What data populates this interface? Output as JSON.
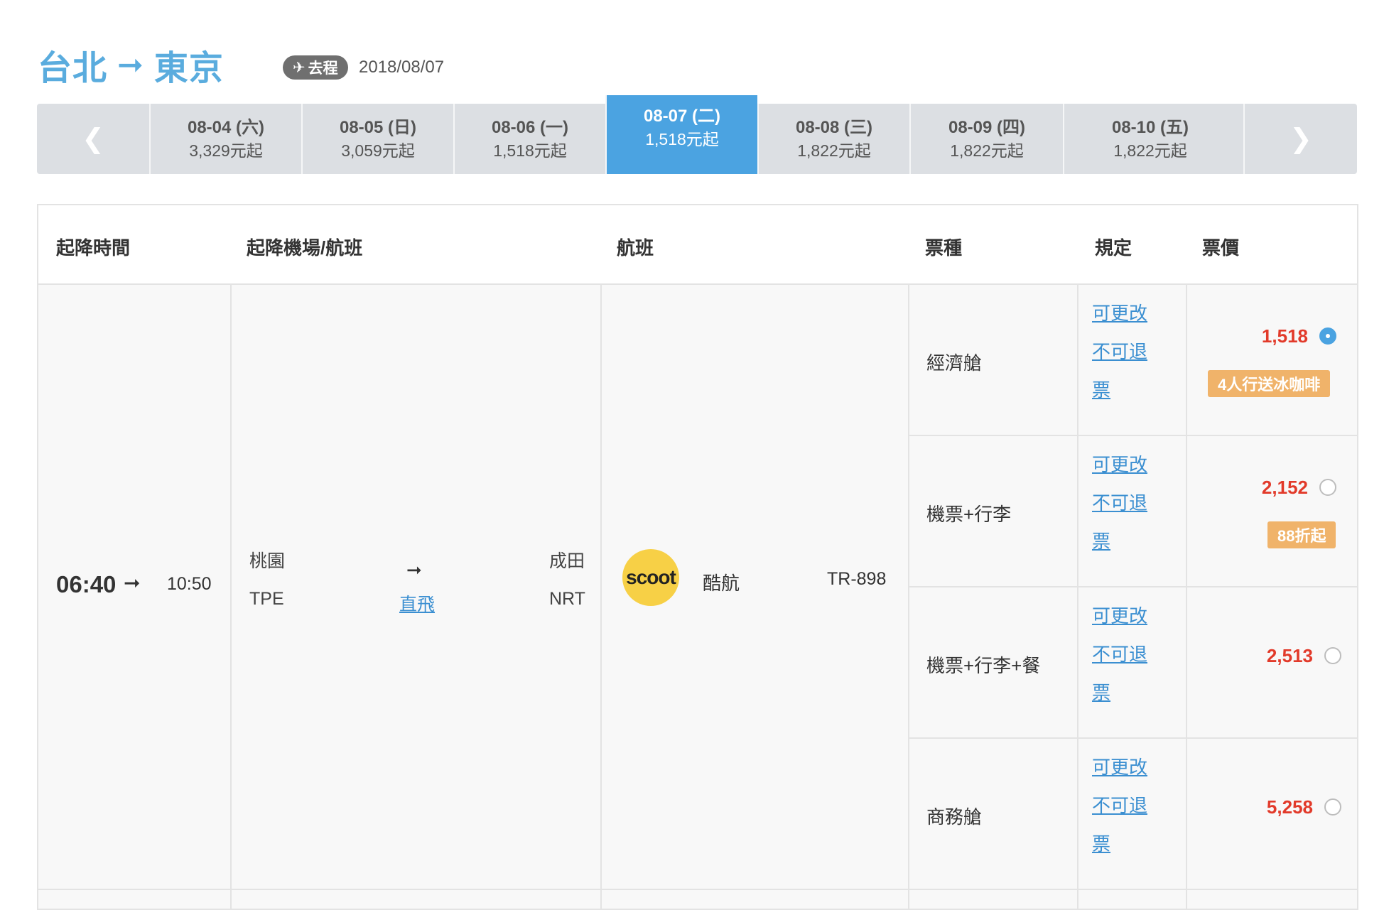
{
  "header": {
    "origin": "台北",
    "arrow": "➞",
    "destination": "東京",
    "trip_type": "去程",
    "trip_icon": "plane-icon",
    "date": "2018/08/07"
  },
  "date_strip": {
    "prev_icon": "chevron-left-icon",
    "next_icon": "chevron-right-icon",
    "tabs": [
      {
        "date": "08-04 (六)",
        "price": "3,329元起",
        "active": false
      },
      {
        "date": "08-05 (日)",
        "price": "3,059元起",
        "active": false
      },
      {
        "date": "08-06 (一)",
        "price": "1,518元起",
        "active": false
      },
      {
        "date": "08-07 (二)",
        "price": "1,518元起",
        "active": true
      },
      {
        "date": "08-08 (三)",
        "price": "1,822元起",
        "active": false
      },
      {
        "date": "08-09 (四)",
        "price": "1,822元起",
        "active": false
      },
      {
        "date": "08-10 (五)",
        "price": "1,822元起",
        "active": false
      }
    ],
    "active_color": "#4ba3e1"
  },
  "table": {
    "headers": {
      "time": "起降時間",
      "airport": "起降機場/航班",
      "flight": "航班",
      "fare_type": "票種",
      "rules": "規定",
      "price": "票價"
    },
    "flight": {
      "depart_time": "06:40",
      "arrow": "➞",
      "arrive_time": "10:50",
      "depart_airport_name": "桃園",
      "depart_airport_code": "TPE",
      "arrive_airport_name": "成田",
      "arrive_airport_code": "NRT",
      "route_type": "直飛",
      "airline_logo_text": "scoot",
      "airline_logo_color": "#f7d046",
      "airline_name": "酷航",
      "flight_number": "TR-898"
    },
    "fares": [
      {
        "name": "經濟艙",
        "rule_change": "可更改",
        "rule_refund": "不可退票",
        "price": "1,518",
        "selected": true,
        "promo": "4人行送冰咖啡"
      },
      {
        "name": "機票+行李",
        "rule_change": "可更改",
        "rule_refund": "不可退票",
        "price": "2,152",
        "selected": false,
        "promo": "88折起"
      },
      {
        "name": "機票+行李+餐",
        "rule_change": "可更改",
        "rule_refund": "不可退票",
        "price": "2,513",
        "selected": false,
        "promo": ""
      },
      {
        "name": "商務艙",
        "rule_change": "可更改",
        "rule_refund": "不可退票",
        "price": "5,258",
        "selected": false,
        "promo": ""
      }
    ],
    "price_color": "#e23a2a",
    "promo_color": "#f0b36a"
  }
}
